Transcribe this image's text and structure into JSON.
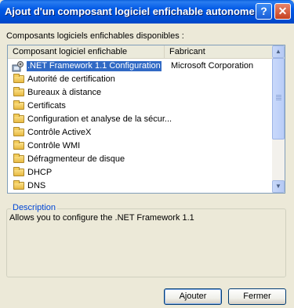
{
  "window": {
    "title": "Ajout d'un composant logiciel enfichable autonome",
    "help_glyph": "?",
    "close_glyph": "✕"
  },
  "available_label": "Composants logiciels enfichables disponibles :",
  "list": {
    "columns": [
      "Composant logiciel enfichable",
      "Fabricant"
    ],
    "rows": [
      {
        "name": ".NET Framework 1.1 Configuration",
        "vendor": "Microsoft Corporation",
        "icon": "net-framework-icon",
        "selected": true
      },
      {
        "name": "Autorité de certification",
        "vendor": "",
        "icon": "folder-icon",
        "selected": false
      },
      {
        "name": "Bureaux à distance",
        "vendor": "",
        "icon": "folder-icon",
        "selected": false
      },
      {
        "name": "Certificats",
        "vendor": "",
        "icon": "folder-icon",
        "selected": false
      },
      {
        "name": "Configuration et analyse de la sécur...",
        "vendor": "",
        "icon": "folder-icon",
        "selected": false
      },
      {
        "name": "Contrôle ActiveX",
        "vendor": "",
        "icon": "folder-icon",
        "selected": false
      },
      {
        "name": "Contrôle WMI",
        "vendor": "",
        "icon": "folder-icon",
        "selected": false
      },
      {
        "name": "Défragmenteur de disque",
        "vendor": "",
        "icon": "folder-icon",
        "selected": false
      },
      {
        "name": "DHCP",
        "vendor": "",
        "icon": "folder-icon",
        "selected": false
      },
      {
        "name": "DNS",
        "vendor": "",
        "icon": "folder-icon",
        "selected": false
      }
    ],
    "scroll": {
      "up_glyph": "▲",
      "down_glyph": "▼"
    }
  },
  "description": {
    "legend": "Description",
    "text": "Allows you to configure the .NET Framework 1.1"
  },
  "buttons": {
    "add": "Ajouter",
    "close": "Fermer"
  },
  "colors": {
    "selection": "#316ac5",
    "titlebar": "#0058e6",
    "legend": "#0046d5"
  }
}
